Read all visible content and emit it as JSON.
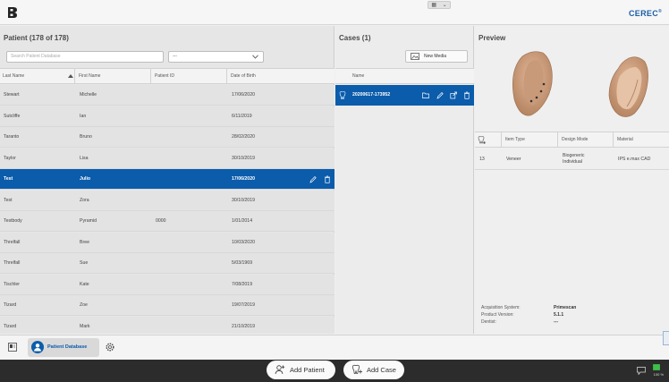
{
  "app": {
    "brand": "CEREC",
    "brand_mark": "®",
    "window_controls": [
      "layout-icon",
      "chevron-down-icon"
    ]
  },
  "patient_panel": {
    "title": "Patient (178 of 178)",
    "search_placeholder": "Search Patient Database",
    "filter_value": "---",
    "columns": [
      "Last Name",
      "First Name",
      "Patient ID",
      "Date of Birth"
    ],
    "rows": [
      {
        "last": "Stewart",
        "first": "Michelle",
        "id": "",
        "dob": "17/06/2020"
      },
      {
        "last": "Sutcliffe",
        "first": "Ian",
        "id": "",
        "dob": "6/11/2019"
      },
      {
        "last": "Taranto",
        "first": "Bruno",
        "id": "",
        "dob": "28/02/2020"
      },
      {
        "last": "Taylor",
        "first": "Lisa",
        "id": "",
        "dob": "30/10/2019"
      },
      {
        "last": "Test",
        "first": "Julio",
        "id": "",
        "dob": "17/06/2020",
        "selected": true
      },
      {
        "last": "Test",
        "first": "Zora",
        "id": "",
        "dob": "30/10/2019"
      },
      {
        "last": "Testbody",
        "first": "Pyramid",
        "id": "0000",
        "dob": "1/01/2014"
      },
      {
        "last": "Threlfall",
        "first": "Bree",
        "id": "",
        "dob": "10/03/2020"
      },
      {
        "last": "Threlfall",
        "first": "Sue",
        "id": "",
        "dob": "5/03/1969"
      },
      {
        "last": "Tischler",
        "first": "Kate",
        "id": "",
        "dob": "7/08/2019"
      },
      {
        "last": "Tizard",
        "first": "Zoe",
        "id": "",
        "dob": "19/07/2019"
      },
      {
        "last": "Tizard",
        "first": "Mark",
        "id": "",
        "dob": "21/10/2019"
      }
    ]
  },
  "cases_panel": {
    "title": "Cases (1)",
    "new_media_label": "New Media",
    "column": "Name",
    "rows": [
      {
        "name": "20200617-173952",
        "selected": true
      }
    ]
  },
  "preview_panel": {
    "title": "Preview",
    "columns": [
      "Item Type",
      "Design Mode",
      "Material"
    ],
    "rows": [
      {
        "tooth": "13",
        "item_type": "Veneer",
        "design_mode_1": "Biogeneric",
        "design_mode_2": "Individual",
        "material": "IPS e.max CAD"
      }
    ],
    "info": [
      {
        "key": "Acquisition System:",
        "value": "Primescan"
      },
      {
        "key": "Product Version:",
        "value": "5.1.1"
      },
      {
        "key": "Dentist:",
        "value": "---"
      }
    ]
  },
  "tabbar": {
    "active_tab": "Patient Database"
  },
  "actions": {
    "add_patient": "Add Patient",
    "add_case": "Add Case"
  },
  "status": {
    "battery": "100 %"
  },
  "colors": {
    "accent": "#0b5cab",
    "brand": "#1b5da7",
    "action_bar": "#2c2c2c"
  }
}
